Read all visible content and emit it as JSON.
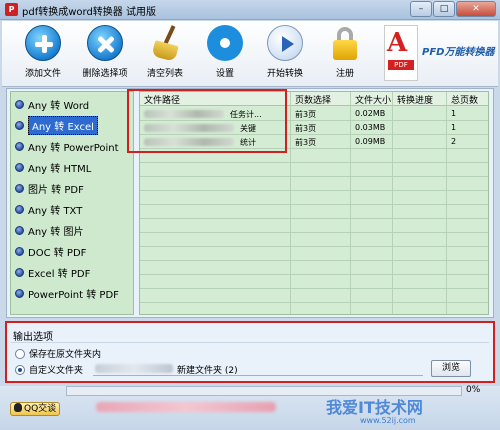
{
  "window": {
    "title": "pdf转换成word转换器 试用版",
    "app_icon_text": "P",
    "min_label": "–",
    "max_label": "□",
    "close_label": "✕"
  },
  "toolbar": {
    "items": [
      {
        "label": "添加文件",
        "icon": "add-file-icon"
      },
      {
        "label": "删除选择项",
        "icon": "delete-icon"
      },
      {
        "label": "清空列表",
        "icon": "broom-icon"
      },
      {
        "label": "设置",
        "icon": "gear-icon"
      },
      {
        "label": "开始转换",
        "icon": "play-icon"
      },
      {
        "label": "注册",
        "icon": "lock-icon"
      }
    ],
    "brand_pdf": "A",
    "brand_tag": "PDF",
    "brand_name": "PFD万能转换器"
  },
  "sidebar": {
    "items": [
      {
        "label": "Any 转 Word",
        "selected": false
      },
      {
        "label": "Any 转 Excel",
        "selected": true
      },
      {
        "label": "Any 转 PowerPoint",
        "selected": false
      },
      {
        "label": "Any 转 HTML",
        "selected": false
      },
      {
        "label": "图片 转 PDF",
        "selected": false
      },
      {
        "label": "Any 转 TXT",
        "selected": false
      },
      {
        "label": "Any 转 图片",
        "selected": false
      },
      {
        "label": "DOC 转 PDF",
        "selected": false
      },
      {
        "label": "Excel 转 PDF",
        "selected": false
      },
      {
        "label": "PowerPoint 转 PDF",
        "selected": false
      }
    ]
  },
  "file_table": {
    "columns": [
      "文件路径",
      "页数选择",
      "文件大小",
      "转换进度",
      "总页数"
    ],
    "rows": [
      {
        "path_suffix": "任务计...",
        "pages_select": "前3页",
        "size": "0.02MB",
        "progress": "",
        "total_pages": "1"
      },
      {
        "path_suffix": "关键",
        "pages_select": "前3页",
        "size": "0.03MB",
        "progress": "",
        "total_pages": "1"
      },
      {
        "path_suffix": "统计",
        "pages_select": "前3页",
        "size": "0.09MB",
        "progress": "",
        "total_pages": "2"
      }
    ]
  },
  "output": {
    "title": "输出选项",
    "option_original": "保存在原文件夹内",
    "option_custom": "自定义文件夹",
    "path_suffix": "新建文件夹 (2)",
    "browse_label": "浏览"
  },
  "bottom": {
    "qq_label": "QQ交谈",
    "progress_percent": 0,
    "progress_text": "0%",
    "watermark": "我爱IT技术网",
    "watermark_sub": "www.52ij.com"
  },
  "colors": {
    "accent_blue": "#2d6bd1",
    "highlight_red": "#d21f1f",
    "list_green": "#d4ecd4"
  }
}
